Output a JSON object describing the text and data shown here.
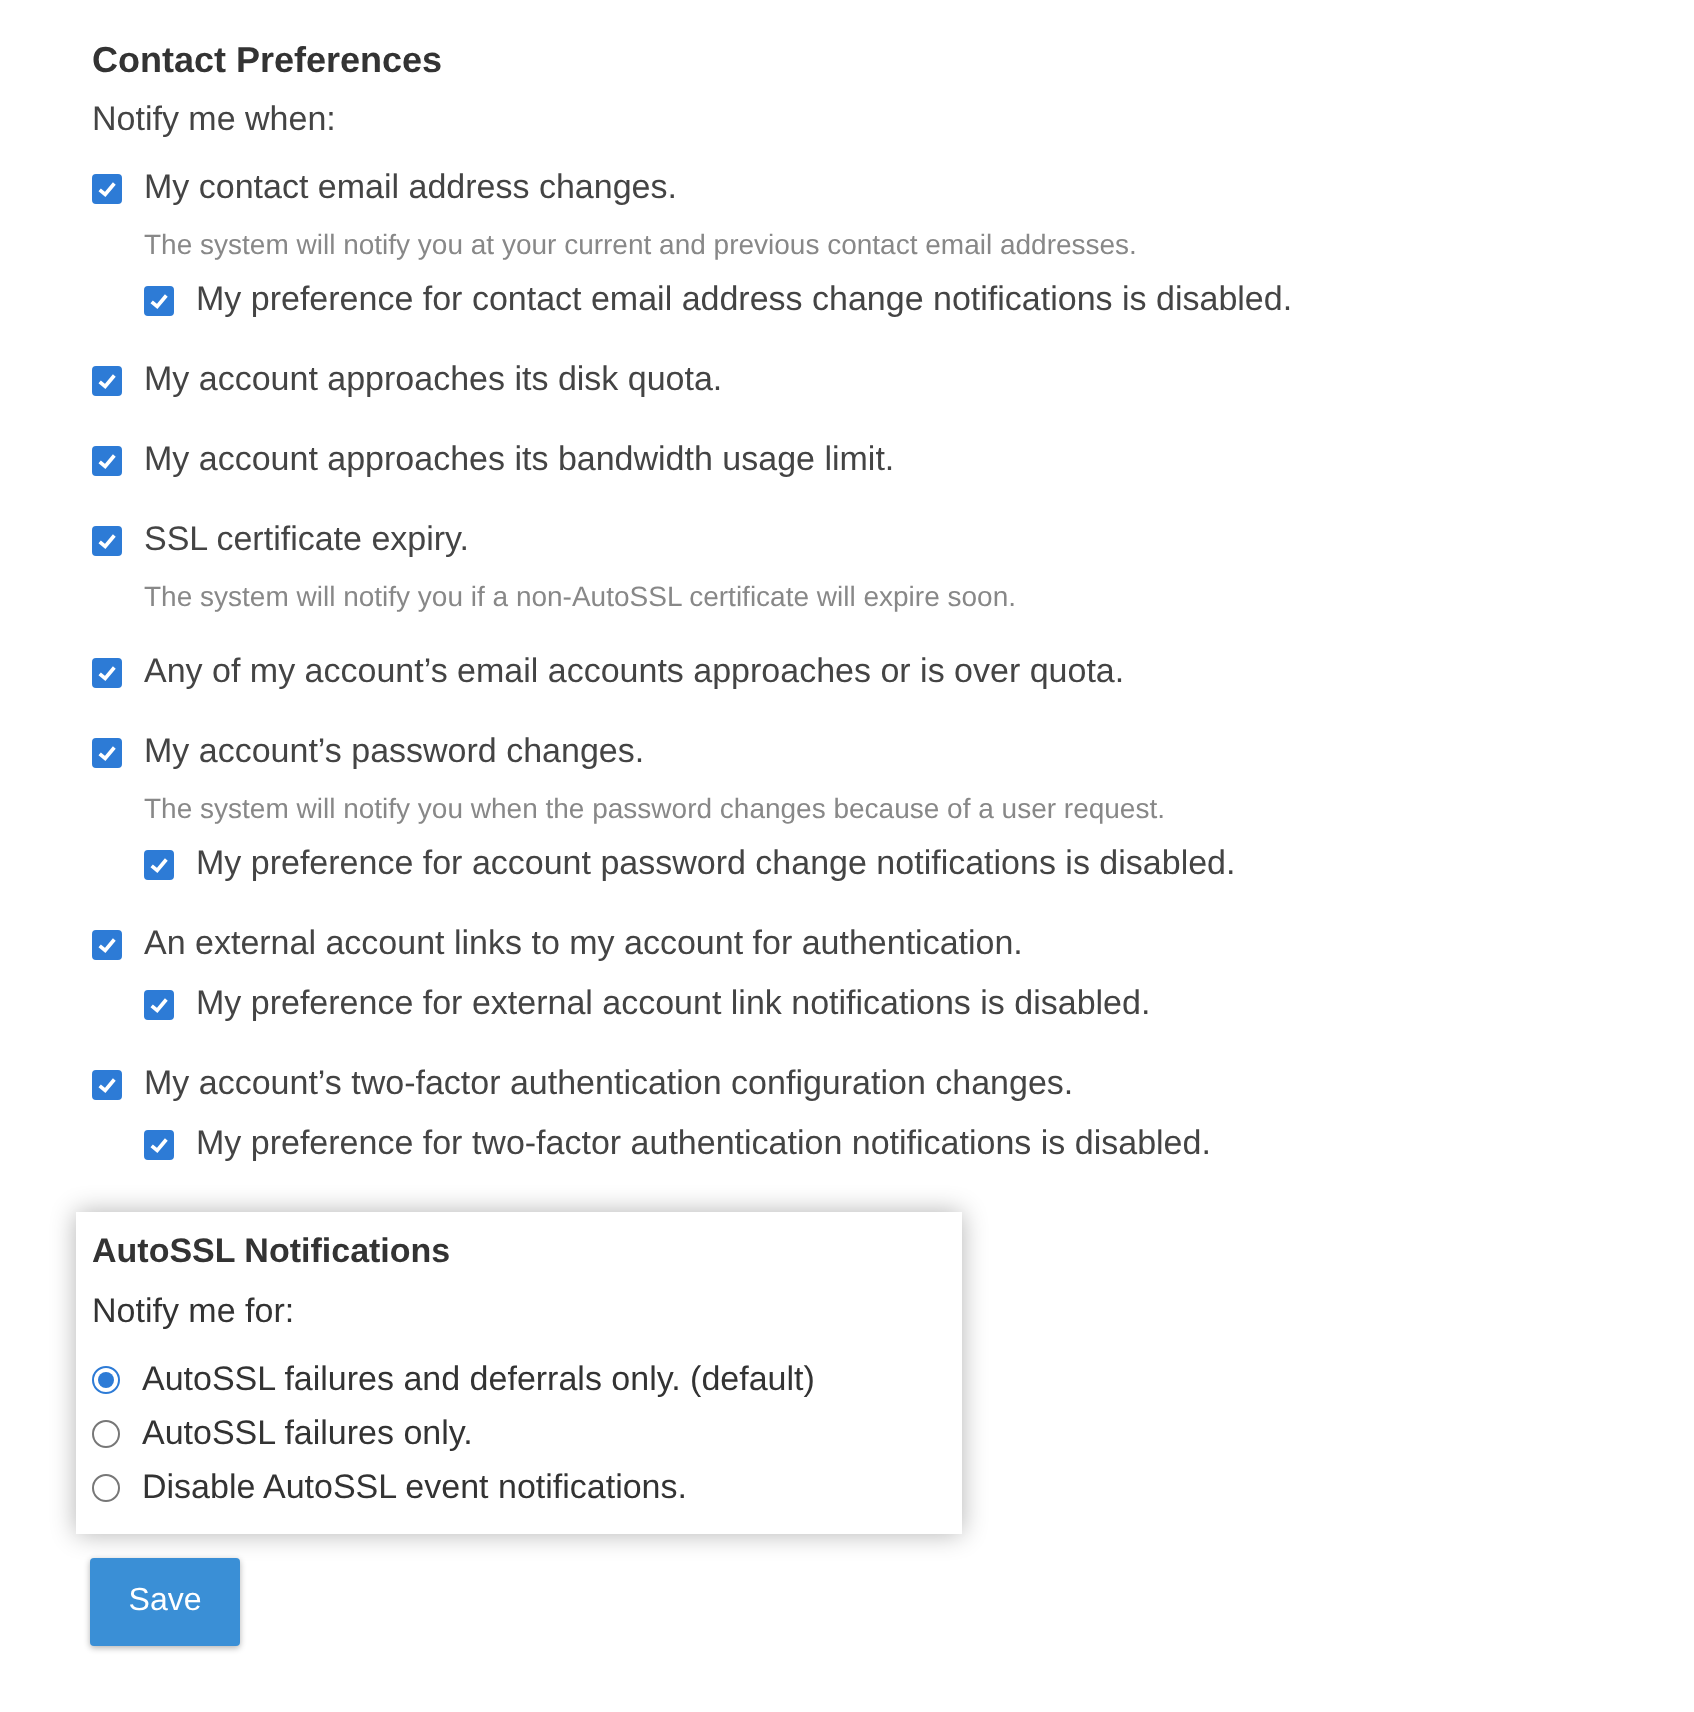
{
  "contact_preferences": {
    "title": "Contact Preferences",
    "intro": "Notify me when:",
    "items": [
      {
        "label": "My contact email address changes.",
        "checked": true,
        "description": "The system will notify you at your current and previous contact email addresses.",
        "children": [
          {
            "label": "My preference for contact email address change notifications is disabled.",
            "checked": true
          }
        ]
      },
      {
        "label": "My account approaches its disk quota.",
        "checked": true
      },
      {
        "label": "My account approaches its bandwidth usage limit.",
        "checked": true
      },
      {
        "label": "SSL certificate expiry.",
        "checked": true,
        "description": "The system will notify you if a non-AutoSSL certificate will expire soon."
      },
      {
        "label": "Any of my account’s email accounts approaches or is over quota.",
        "checked": true
      },
      {
        "label": "My account’s password changes.",
        "checked": true,
        "description": "The system will notify you when the password changes because of a user request.",
        "children": [
          {
            "label": "My preference for account password change notifications is disabled.",
            "checked": true
          }
        ]
      },
      {
        "label": "An external account links to my account for authentication.",
        "checked": true,
        "children": [
          {
            "label": "My preference for external account link notifications is disabled.",
            "checked": true
          }
        ]
      },
      {
        "label": "My account’s two-factor authentication configuration changes.",
        "checked": true,
        "children": [
          {
            "label": "My preference for two-factor authentication notifications is disabled.",
            "checked": true
          }
        ]
      }
    ]
  },
  "autossl_notifications": {
    "title": "AutoSSL Notifications",
    "intro": "Notify me for:",
    "options": [
      {
        "label": "AutoSSL failures and deferrals only. (default)",
        "selected": true
      },
      {
        "label": "AutoSSL failures only.",
        "selected": false
      },
      {
        "label": "Disable AutoSSL event notifications.",
        "selected": false
      }
    ]
  },
  "save_button": "Save"
}
